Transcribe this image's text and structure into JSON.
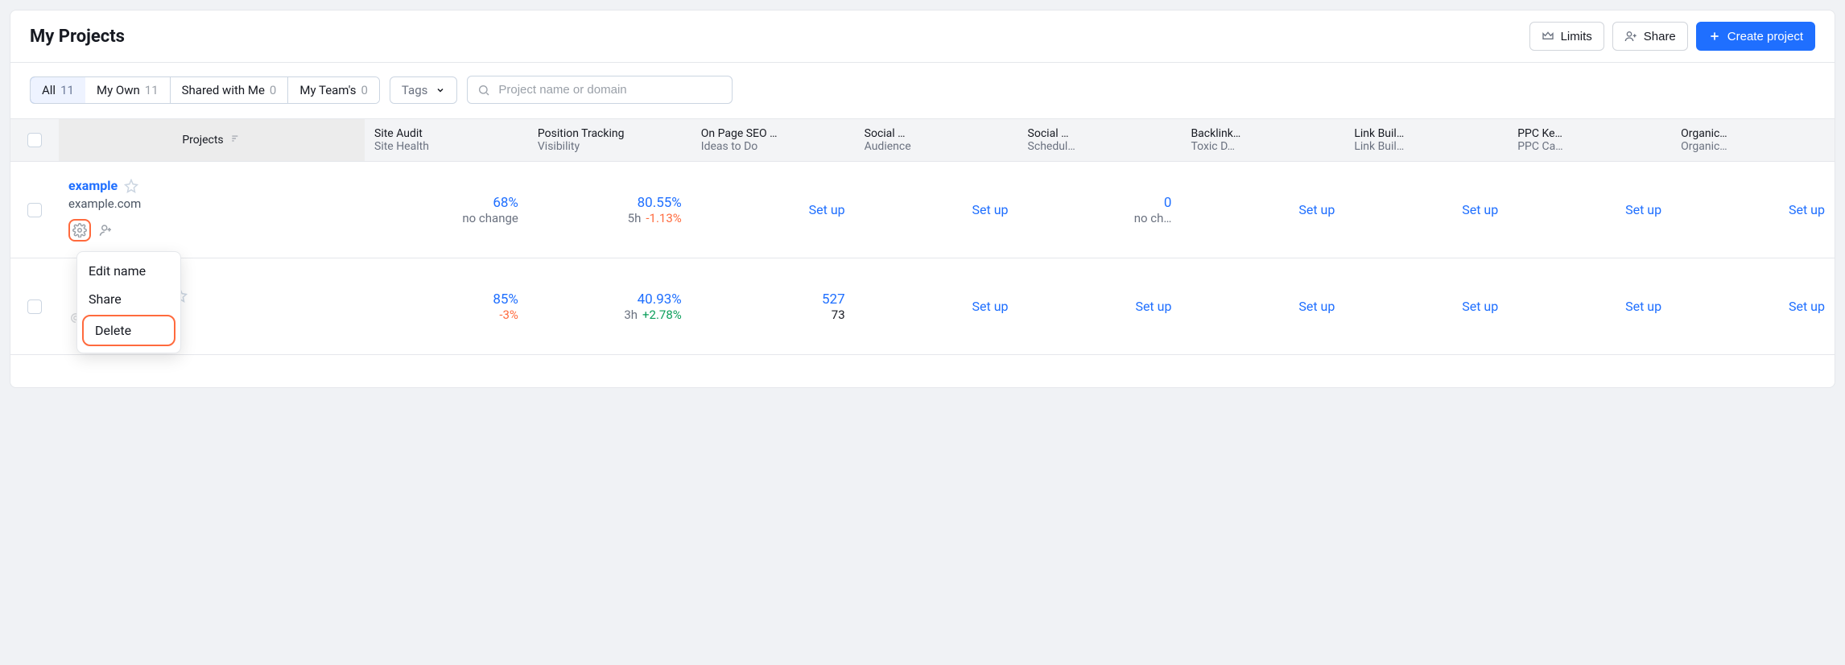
{
  "header": {
    "title": "My Projects",
    "limits": "Limits",
    "share": "Share",
    "create": "Create project"
  },
  "filters": {
    "tabs": [
      {
        "label": "All",
        "count": "11"
      },
      {
        "label": "My Own",
        "count": "11"
      },
      {
        "label": "Shared with Me",
        "count": "0"
      },
      {
        "label": "My Team's",
        "count": "0"
      }
    ],
    "tags_label": "Tags",
    "search_placeholder": "Project name or domain"
  },
  "columns": {
    "projects": "Projects",
    "c1": {
      "line1": "Site Audit",
      "line2": "Site Health"
    },
    "c2": {
      "line1": "Position Tracking",
      "line2": "Visibility"
    },
    "c3": {
      "line1": "On Page SEO …",
      "line2": "Ideas to Do"
    },
    "c4": {
      "line1": "Social …",
      "line2": "Audience"
    },
    "c5": {
      "line1": "Social …",
      "line2": "Schedul…"
    },
    "c6": {
      "line1": "Backlink…",
      "line2": "Toxic D…"
    },
    "c7": {
      "line1": "Link Buil…",
      "line2": "Link Buil…"
    },
    "c8": {
      "line1": "PPC Ke…",
      "line2": "PPC Ca…"
    },
    "c9": {
      "line1": "Organic…",
      "line2": "Organic…"
    }
  },
  "rows": [
    {
      "name": "example",
      "domain": "example.com",
      "site_audit": {
        "value": "68%",
        "sub": "no change"
      },
      "position": {
        "value": "80.55%",
        "sub_prefix": "5h ",
        "sub_change": "-1.13%",
        "dir": "neg"
      },
      "onpage": {
        "setup": "Set up"
      },
      "social1": {
        "setup": "Set up"
      },
      "social2": {
        "value": "0",
        "sub": "no ch…"
      },
      "backlink": {
        "setup": "Set up"
      },
      "linkb": {
        "setup": "Set up"
      },
      "ppc": {
        "setup": "Set up"
      },
      "organic": {
        "setup": "Set up"
      }
    },
    {
      "name": "",
      "domain": "",
      "site_audit": {
        "value": "85%",
        "sub": "-3%",
        "dir": "neg"
      },
      "position": {
        "value": "40.93%",
        "sub_prefix": "3h ",
        "sub_change": "+2.78%",
        "dir": "pos"
      },
      "onpage": {
        "value": "527",
        "sub": "73"
      },
      "social1": {
        "setup": "Set up"
      },
      "social2": {
        "setup": "Set up"
      },
      "backlink": {
        "setup": "Set up"
      },
      "linkb": {
        "setup": "Set up"
      },
      "ppc": {
        "setup": "Set up"
      },
      "organic": {
        "setup": "Set up"
      }
    }
  ],
  "popover": {
    "edit": "Edit name",
    "share": "Share",
    "delete": "Delete"
  },
  "setup_label": "Set up"
}
